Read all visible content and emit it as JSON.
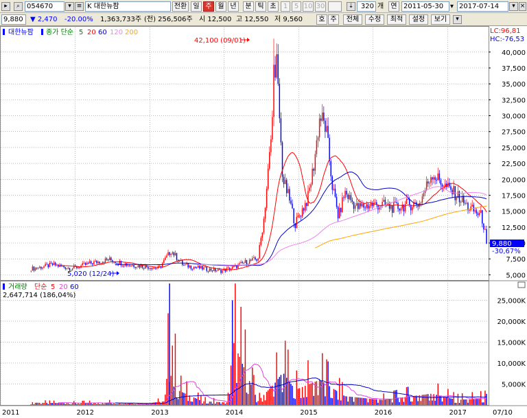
{
  "toolbar": {
    "code": "054670",
    "name": "K 대한뉴팜",
    "periods": [
      "일",
      "주",
      "월",
      "년",
      "분",
      "틱",
      "초"
    ],
    "active_period": "주",
    "minute_buttons": [
      "1",
      "5",
      "10",
      "30"
    ],
    "count": "320",
    "count_unit": "개",
    "year_label": "연",
    "date_from": "2011-05-30",
    "date_to": "2017-07-14",
    "convert_label": "전환"
  },
  "quote": {
    "price": "9,880",
    "change": "▼ 2,470",
    "change_pct": "-20.00%",
    "volume": "1,363,733주",
    "prev_volume": "(전) 256,506주",
    "open": "시 12,500",
    "high": "고 12,550",
    "low": "저 9,560",
    "buttons": [
      "호",
      "주",
      "전체",
      "수정",
      "최적",
      "설정",
      "보기"
    ]
  },
  "colors": {
    "up": "#ff0000",
    "down": "#0000ff",
    "ma5": "#ff0000",
    "ma20": "#ff0000",
    "ma60": "#0000c8",
    "ma120": "#ee82ee",
    "ma200": "#ffa500",
    "vol_ma5": "#ff0000",
    "vol_ma20": "#e040e0",
    "vol_ma60": "#0000c8",
    "grid": "#909090"
  },
  "price_panel": {
    "legend_name": "대한뉴팜",
    "legend_ma_prefix": "종가 단순",
    "legend_ma_periods": [
      "5",
      "20",
      "60",
      "120",
      "200"
    ],
    "lc": "LC:96,81",
    "hc": "HC:-76,53",
    "y_ticks": [
      "40,000",
      "37,500",
      "35,000",
      "32,500",
      "30,000",
      "27,500",
      "25,000",
      "22,500",
      "20,000",
      "17,500",
      "15,000",
      "12,500",
      "10,000",
      "7,500",
      "5,000"
    ],
    "last_price_label": "9,880",
    "last_change_label": "-30,67%",
    "max_annotation": "42,100 (09/01)",
    "min_annotation": "5,020 (12/24)"
  },
  "volume_panel": {
    "legend_name": "거래량",
    "legend_ma_prefix": "단순",
    "legend_ma_periods": [
      "5",
      "20",
      "60"
    ],
    "last_volume": "2,647,714 (186,04%)",
    "y_ticks": [
      "25,000K",
      "20,000K",
      "15,000K",
      "10,000K",
      "5,000K"
    ]
  },
  "x_axis": {
    "labels": [
      "2011",
      "2012",
      "2013",
      "2014",
      "2015",
      "2016",
      "2017",
      "07/10"
    ]
  },
  "chart_data": {
    "type": "candlestick",
    "period": "weekly",
    "x_range": [
      "2011-05-30",
      "2017-07-14"
    ],
    "price_ylim": [
      4500,
      43000
    ],
    "volume_ylim": [
      0,
      29000
    ],
    "volume_unit": "K shares",
    "series": [
      {
        "name": "대한뉴팜",
        "kind": "close",
        "points": [
          [
            "2011-06",
            6000
          ],
          [
            "2011-09",
            6600
          ],
          [
            "2011-12",
            6000
          ],
          [
            "2012-03",
            6800
          ],
          [
            "2012-06",
            7400
          ],
          [
            "2012-09",
            6600
          ],
          [
            "2012-12",
            6300
          ],
          [
            "2013-02",
            6000
          ],
          [
            "2013-04",
            8800
          ],
          [
            "2013-06",
            6500
          ],
          [
            "2013-09",
            6000
          ],
          [
            "2013-12",
            5600
          ],
          [
            "2014-02",
            6100
          ],
          [
            "2014-04",
            7000
          ],
          [
            "2014-06",
            7500
          ],
          [
            "2014-07",
            14000
          ],
          [
            "2014-08",
            25000
          ],
          [
            "2014-09",
            38000
          ],
          [
            "2014-10",
            20000
          ],
          [
            "2014-11",
            17000
          ],
          [
            "2014-12",
            13000
          ],
          [
            "2015-01",
            15000
          ],
          [
            "2015-02",
            17000
          ],
          [
            "2015-03",
            22000
          ],
          [
            "2015-04",
            30000
          ],
          [
            "2015-05",
            28000
          ],
          [
            "2015-06",
            19000
          ],
          [
            "2015-07",
            14000
          ],
          [
            "2015-08",
            18000
          ],
          [
            "2015-10",
            15500
          ],
          [
            "2015-12",
            16000
          ],
          [
            "2016-02",
            16000
          ],
          [
            "2016-04",
            15500
          ],
          [
            "2016-06",
            16000
          ],
          [
            "2016-08",
            16200
          ],
          [
            "2016-10",
            21000
          ],
          [
            "2016-12",
            19000
          ],
          [
            "2017-02",
            17500
          ],
          [
            "2017-04",
            15500
          ],
          [
            "2017-06",
            14300
          ],
          [
            "2017-07",
            9880
          ]
        ]
      },
      {
        "name": "5",
        "kind": "ma"
      },
      {
        "name": "20",
        "kind": "ma"
      },
      {
        "name": "60",
        "kind": "ma"
      },
      {
        "name": "120",
        "kind": "ma"
      },
      {
        "name": "200",
        "kind": "ma"
      }
    ],
    "volume": {
      "name": "거래량",
      "points": [
        [
          "2011-06",
          900
        ],
        [
          "2011-12",
          700
        ],
        [
          "2012-06",
          900
        ],
        [
          "2012-12",
          600
        ],
        [
          "2013-03",
          1500
        ],
        [
          "2013-04",
          29000
        ],
        [
          "2013-05",
          6000
        ],
        [
          "2013-09",
          1500
        ],
        [
          "2014-01",
          1000
        ],
        [
          "2014-02",
          25000
        ],
        [
          "2014-06",
          1500
        ],
        [
          "2014-09",
          9500
        ],
        [
          "2014-10",
          13000
        ],
        [
          "2014-12",
          6000
        ],
        [
          "2015-04",
          10000
        ],
        [
          "2015-08",
          3500
        ],
        [
          "2016-02",
          2000
        ],
        [
          "2016-10",
          4500
        ],
        [
          "2017-02",
          2000
        ],
        [
          "2017-07",
          2648
        ]
      ]
    },
    "annotations": [
      {
        "text": "42,100 (09/01)",
        "x": "2014-09-01",
        "y": 42100
      },
      {
        "text": "5,020 (12/24)",
        "x": "2012-12-24",
        "y": 5020
      }
    ]
  }
}
